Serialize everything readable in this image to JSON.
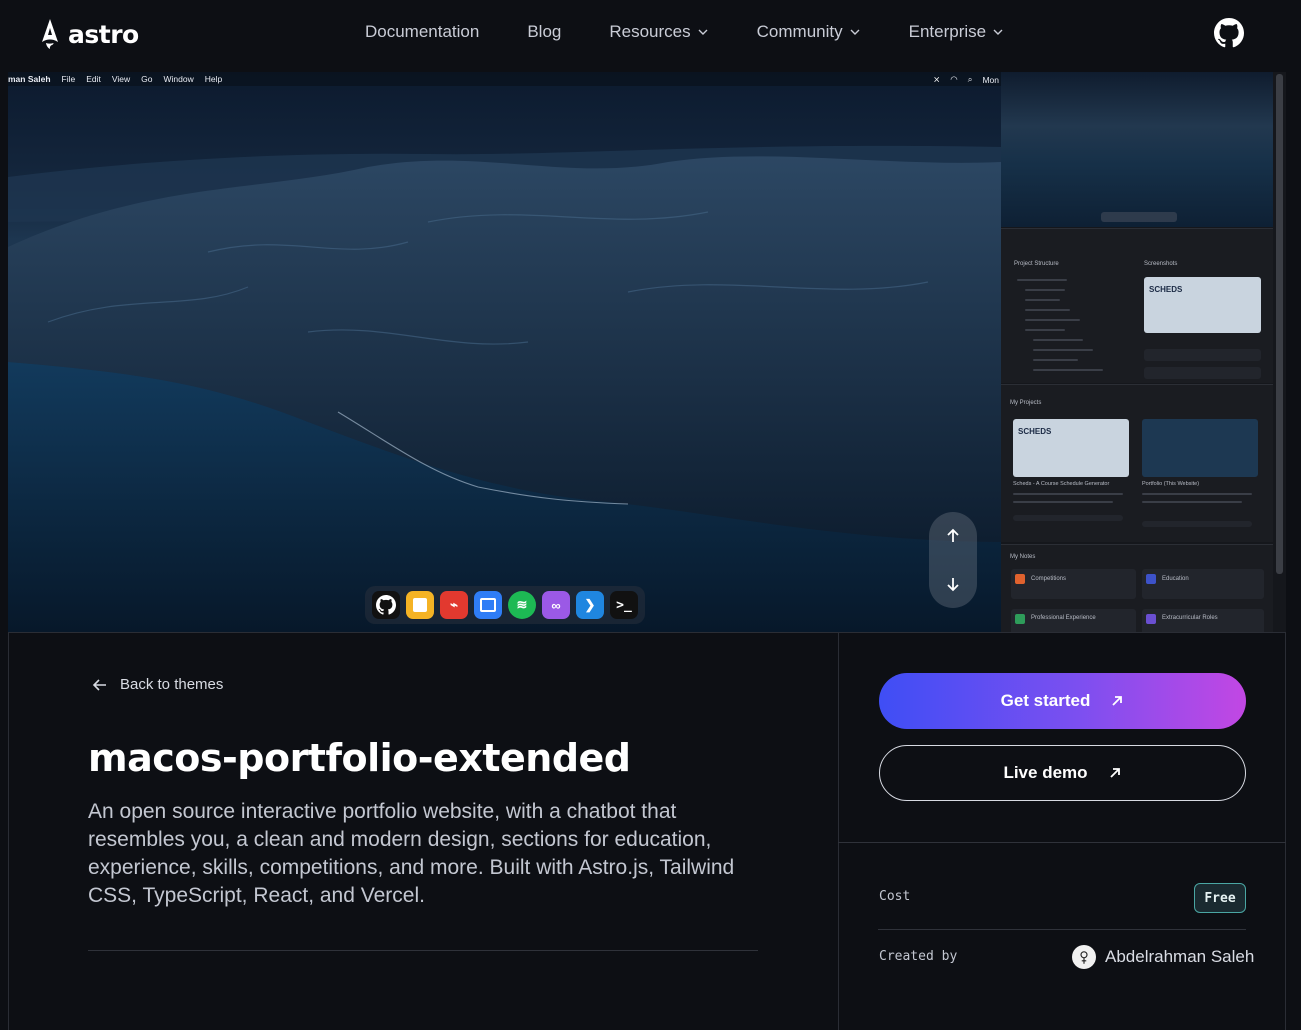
{
  "nav": {
    "logo_text": "astro",
    "items": [
      {
        "label": "Documentation",
        "has_dropdown": false
      },
      {
        "label": "Blog",
        "has_dropdown": false
      },
      {
        "label": "Resources",
        "has_dropdown": true
      },
      {
        "label": "Community",
        "has_dropdown": true
      },
      {
        "label": "Enterprise",
        "has_dropdown": true
      }
    ],
    "github_icon": "github-icon"
  },
  "screenshot": {
    "menubar": {
      "owner": "man Saleh",
      "items": [
        "File",
        "Edit",
        "View",
        "Go",
        "Window",
        "Help"
      ],
      "clock": "Mon"
    },
    "dock_icons": [
      "github-icon",
      "notes-icon",
      "pdf-icon",
      "browser-icon",
      "spotify-icon",
      "link-icon",
      "vscode-icon",
      "terminal-icon"
    ],
    "side_preview": {
      "project_structure": "Project Structure",
      "screenshots": "Screenshots",
      "scheds_label": "SCHEDS",
      "my_projects": "My Projects",
      "project_1": "Scheds - A Course Schedule Generator",
      "project_2": "Portfolio (This Website)",
      "my_notes": "My Notes",
      "note_competitions": "Competitions",
      "note_education": "Education",
      "note_professional": "Professional Experience",
      "note_extracurricular": "Extracurricular Roles"
    }
  },
  "back": {
    "label": "Back to themes"
  },
  "theme": {
    "title": "macos-portfolio-extended",
    "description": "An open source interactive portfolio website, with a chatbot that resembles you, a clean and modern design, sections for education, experience, skills, competitions, and more. Built with Astro.js, Tailwind CSS, TypeScript, React, and Vercel."
  },
  "actions": {
    "get_started": "Get started",
    "live_demo": "Live demo"
  },
  "meta": {
    "cost_label": "Cost",
    "cost_value": "Free",
    "created_by_label": "Created by",
    "creator_name": "Abdelrahman Saleh"
  },
  "colors": {
    "background": "#0d0f14",
    "primary_gradient_start": "#3f4ef5",
    "primary_gradient_end": "#c247e3",
    "badge_border": "#4aa6a3"
  }
}
